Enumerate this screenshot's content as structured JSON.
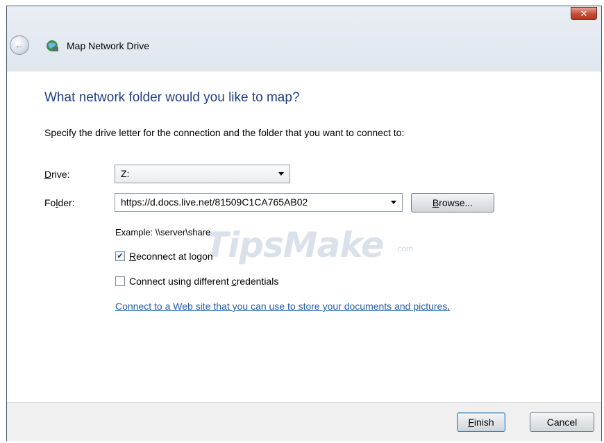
{
  "window": {
    "title": "Map Network Drive",
    "close_glyph": "✕"
  },
  "icons": {
    "back": "back-arrow-icon",
    "app": "network-drive-icon",
    "dropdown": "chevron-down-icon"
  },
  "main": {
    "heading": "What network folder would you like to map?",
    "instruction": "Specify the drive letter for the connection and the folder that you want to connect to:",
    "drive": {
      "label_mnemonic": "D",
      "label_rest": "rive:",
      "value": "Z:"
    },
    "folder": {
      "label_prefix": "Fo",
      "label_mnemonic": "l",
      "label_rest": "der:",
      "value": "https://d.docs.live.net/81509C1CA765AB02",
      "browse_mnemonic": "B",
      "browse_rest": "rowse..."
    },
    "example": "Example: \\\\server\\share",
    "reconnect": {
      "mnemonic": "R",
      "rest": "econnect at logon",
      "checked": true
    },
    "credentials": {
      "prefix": "Connect using different ",
      "mnemonic": "c",
      "rest": "redentials",
      "checked": false
    },
    "link": "Connect to a Web site that you can use to store your documents and pictures",
    "link_period": "."
  },
  "watermark": {
    "text": "TipsMake",
    "sub": ".com"
  },
  "footer": {
    "finish_mnemonic": "F",
    "finish_rest": "inish",
    "cancel": "Cancel"
  },
  "colors": {
    "heading": "#1e3f87",
    "link": "#1b5fb0",
    "close": "#c7503c"
  }
}
